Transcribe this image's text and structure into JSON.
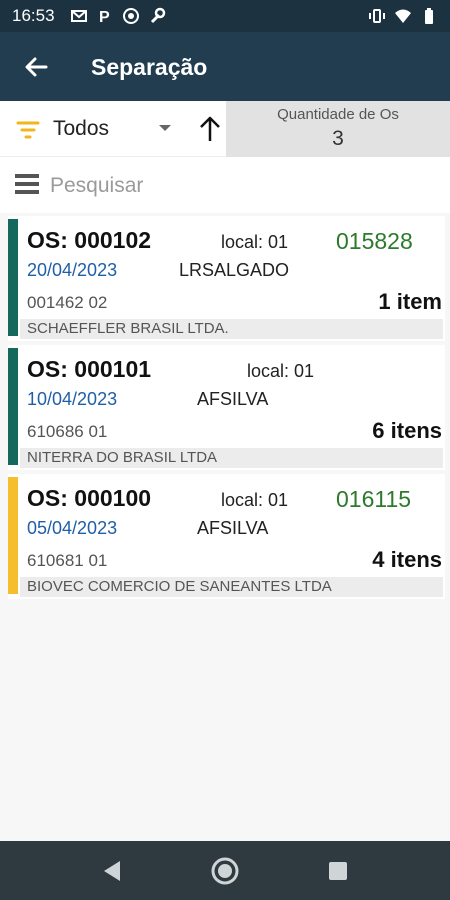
{
  "status_bar": {
    "time": "16:53",
    "icons": [
      "gmail-icon",
      "p-icon",
      "sync-icon",
      "wrench-icon"
    ],
    "right_icons": [
      "vibrate-icon",
      "wifi-icon",
      "battery-icon"
    ]
  },
  "app_bar": {
    "title": "Separação",
    "back_icon": "arrow-left-icon",
    "bg": "#233d50"
  },
  "filter": {
    "selected": "Todos",
    "filter_icon": "filter-lines-icon",
    "sort_icon": "arrow-up-icon",
    "quantity_label": "Quantidade de Os",
    "quantity_value": "3",
    "accent": "#f2b51c"
  },
  "search": {
    "placeholder": "Pesquisar",
    "icon": "list-bars-icon"
  },
  "orders": [
    {
      "os": "OS: 000102",
      "local": "local: 01",
      "code": "015828",
      "date": "20/04/2023",
      "user": "LRSALGADO",
      "ref": "001462 02",
      "items": "1 item",
      "client": "SCHAEFFLER BRASIL LTDA.",
      "stripe_color": "#14695c"
    },
    {
      "os": "OS: 000101",
      "local": "local: 01",
      "code": "",
      "date": "10/04/2023",
      "user": "AFSILVA",
      "ref": "610686 01",
      "items": "6 itens",
      "client": "NITERRA DO BRASIL LTDA",
      "stripe_color": "#14695c"
    },
    {
      "os": "OS: 000100",
      "local": "local: 01",
      "code": "016115",
      "date": "05/04/2023",
      "user": "AFSILVA",
      "ref": "610681 01",
      "items": "4 itens",
      "client": "BIOVEC COMERCIO DE SANEANTES LTDA",
      "stripe_color": "#f4bf2a"
    }
  ],
  "nav_bar": {
    "buttons": [
      "back-triangle-icon",
      "home-circle-icon",
      "recents-square-icon"
    ]
  }
}
